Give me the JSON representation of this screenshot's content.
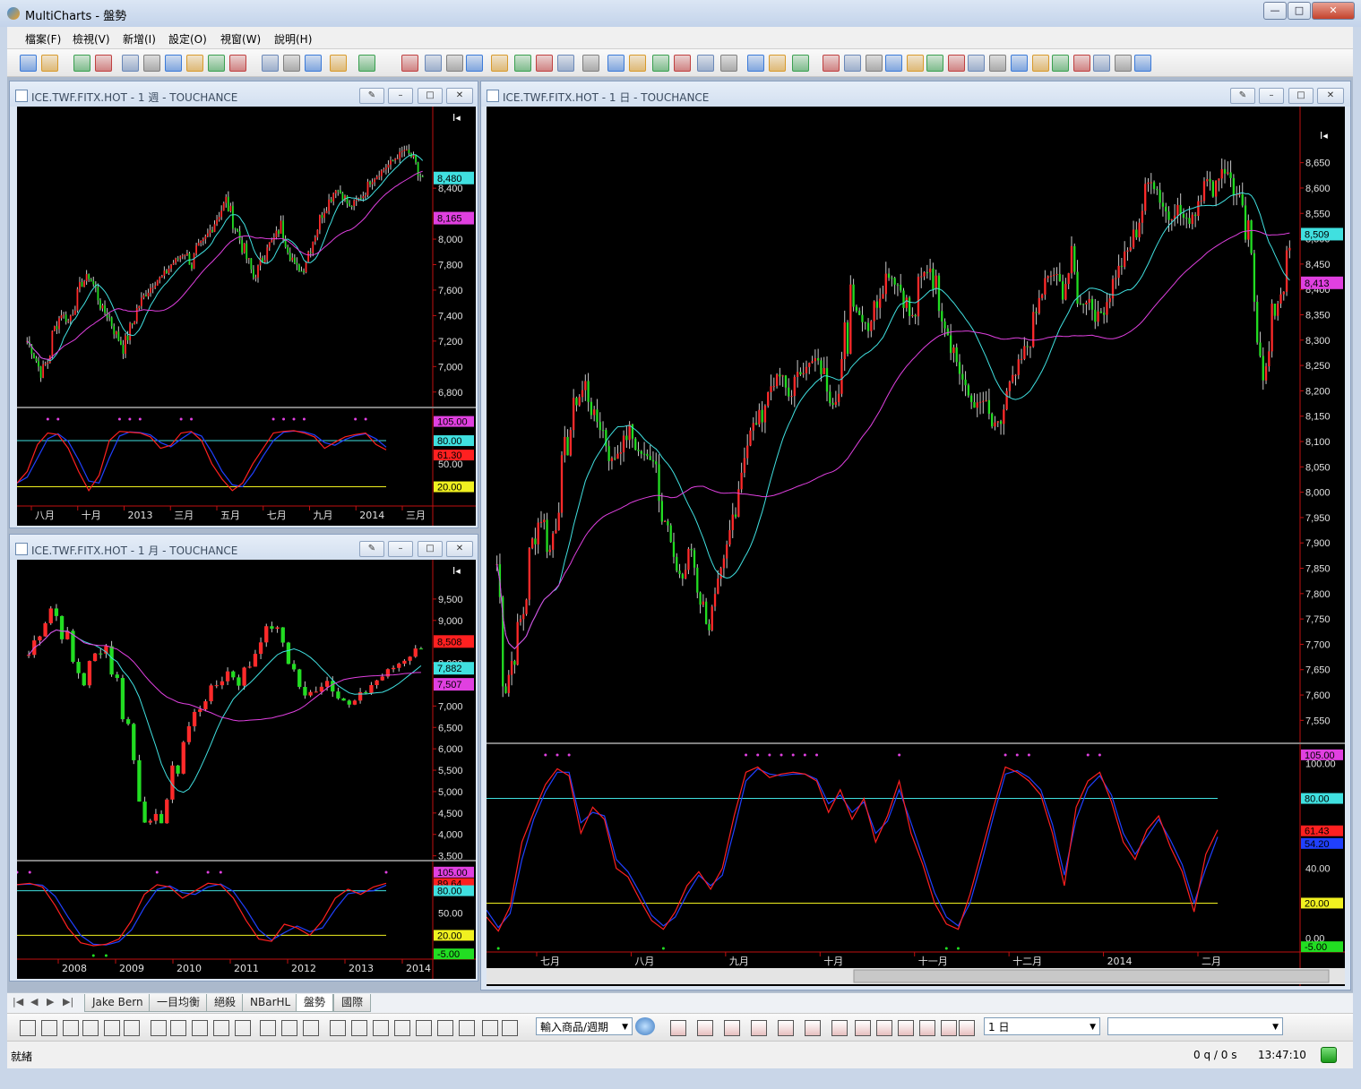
{
  "app": {
    "title": "MultiCharts - 盤勢"
  },
  "menu": [
    "檔案(F)",
    "檢視(V)",
    "新增(I)",
    "設定(O)",
    "視窗(W)",
    "說明(H)"
  ],
  "windows": {
    "weekly": {
      "title": "ICE.TWF.FITX.HOT - 1 週 - TOUCHANCE"
    },
    "monthly": {
      "title": "ICE.TWF.FITX.HOT - 1 月 - TOUCHANCE"
    },
    "daily": {
      "title": "ICE.TWF.FITX.HOT - 1 日 - TOUCHANCE"
    }
  },
  "tabs": [
    "Jake Bern",
    "一目均衡",
    "絕殺",
    "NBarHL",
    "盤勢",
    "國際"
  ],
  "active_tab": "盤勢",
  "symbol_combo": "輸入商品/週期",
  "interval_combo": "1 日",
  "status": {
    "text": "就緒",
    "queue": "0 q / 0 s",
    "time": "13:47:10"
  },
  "colors": {
    "up": "#ff2a2a",
    "down": "#22dd22",
    "fast_ma": "#40e0e0",
    "slow_ma": "#e040e0",
    "k_line": "#ff2020",
    "d_line": "#2040ff",
    "level_high": "#40e0e0",
    "level_low": "#f0f020"
  },
  "chart_data": [
    {
      "id": "daily",
      "type": "candlestick",
      "price_ticks": [
        "8,650",
        "8,600",
        "8,550",
        "8,500",
        "8,450",
        "8,400",
        "8,350",
        "8,300",
        "8,250",
        "8,200",
        "8,150",
        "8,100",
        "8,050",
        "8,000",
        "7,950",
        "7,900",
        "7,850",
        "7,800",
        "7,750",
        "7,700",
        "7,650",
        "7,600",
        "7,550"
      ],
      "price_range": [
        7510,
        8690
      ],
      "price_tags": [
        {
          "label": "8,509",
          "value": 8509,
          "color": "#40e0e0"
        },
        {
          "label": "8,413",
          "value": 8413,
          "color": "#e040e0"
        }
      ],
      "close_path": [
        7860,
        7620,
        7690,
        7770,
        7900,
        7960,
        7880,
        8000,
        8100,
        8180,
        8210,
        8150,
        8120,
        8060,
        8090,
        8120,
        8080,
        8070,
        8060,
        7950,
        7860,
        7830,
        7890,
        7790,
        7740,
        7800,
        7870,
        7990,
        8080,
        8130,
        8160,
        8210,
        8230,
        8190,
        8230,
        8250,
        8260,
        8230,
        8180,
        8200,
        8410,
        8350,
        8330,
        8380,
        8430,
        8420,
        8390,
        8330,
        8420,
        8450,
        8380,
        8320,
        8260,
        8200,
        8170,
        8180,
        8130,
        8140,
        8210,
        8240,
        8290,
        8350,
        8420,
        8430,
        8400,
        8450,
        8370,
        8380,
        8340,
        8380,
        8430,
        8460,
        8500,
        8560,
        8630,
        8580,
        8540,
        8560,
        8530,
        8560,
        8620,
        8600,
        8640,
        8620,
        8560,
        8480,
        8340,
        8220,
        8360,
        8420,
        8500
      ],
      "osc_ticks": [
        "100.00",
        "40.00",
        "0.00"
      ],
      "osc_range": [
        -8,
        108
      ],
      "osc_levels": [
        80,
        20
      ],
      "osc_tags": [
        {
          "label": "105.00",
          "value": 105,
          "color": "#e040e0"
        },
        {
          "label": "80.00",
          "value": 80,
          "color": "#40e0e0"
        },
        {
          "label": "61.43",
          "value": 61.43,
          "color": "#ff2020"
        },
        {
          "label": "54.20",
          "value": 54.2,
          "color": "#2040ff"
        },
        {
          "label": "20.00",
          "value": 20,
          "color": "#f0f020"
        },
        {
          "label": "-5.00",
          "value": -5,
          "color": "#22dd22"
        }
      ],
      "osc_k": [
        12,
        4,
        18,
        55,
        72,
        88,
        97,
        93,
        60,
        75,
        68,
        40,
        35,
        22,
        10,
        5,
        15,
        30,
        38,
        28,
        40,
        70,
        95,
        98,
        92,
        94,
        95,
        94,
        90,
        72,
        85,
        68,
        80,
        55,
        70,
        90,
        60,
        42,
        20,
        8,
        5,
        25,
        50,
        75,
        98,
        95,
        90,
        82,
        60,
        30,
        75,
        90,
        95,
        78,
        55,
        45,
        62,
        70,
        52,
        38,
        15,
        48,
        62
      ],
      "osc_d": [
        16,
        6,
        14,
        45,
        68,
        84,
        95,
        95,
        66,
        72,
        70,
        45,
        38,
        26,
        13,
        7,
        12,
        25,
        36,
        30,
        36,
        62,
        90,
        97,
        94,
        93,
        94,
        94,
        91,
        77,
        82,
        72,
        78,
        60,
        67,
        85,
        66,
        46,
        26,
        12,
        7,
        20,
        44,
        70,
        94,
        96,
        92,
        85,
        65,
        36,
        68,
        86,
        93,
        82,
        60,
        48,
        58,
        68,
        56,
        42,
        20,
        40,
        58
      ],
      "x_labels": [
        "七月",
        "八月",
        "九月",
        "十月",
        "十一月",
        "十二月",
        "2014",
        "二月"
      ]
    },
    {
      "id": "weekly",
      "type": "candlestick",
      "price_ticks": [
        "8,400",
        "8,000",
        "7,800",
        "7,600",
        "7,400",
        "7,200",
        "7,000",
        "6,800"
      ],
      "price_range": [
        6700,
        8900
      ],
      "price_tags": [
        {
          "label": "8,480",
          "value": 8480,
          "color": "#40e0e0"
        },
        {
          "label": "8,165",
          "value": 8165,
          "color": "#e040e0"
        }
      ],
      "close_path": [
        7200,
        7100,
        6950,
        7050,
        7300,
        7420,
        7350,
        7500,
        7650,
        7720,
        7600,
        7450,
        7380,
        7250,
        7150,
        7280,
        7450,
        7550,
        7620,
        7680,
        7720,
        7800,
        7850,
        7900,
        7800,
        7950,
        8000,
        8100,
        8200,
        8300,
        8150,
        8000,
        7850,
        7700,
        7800,
        7950,
        8000,
        8100,
        7950,
        7800,
        7750,
        7900,
        8050,
        8200,
        8300,
        8400,
        8350,
        8250,
        8300,
        8350,
        8450,
        8500,
        8550,
        8600,
        8650,
        8700,
        8650,
        8500,
        8480
      ],
      "osc_ticks": [
        "50.00"
      ],
      "osc_range": [
        -5,
        115
      ],
      "osc_levels": [
        80,
        20
      ],
      "osc_tags": [
        {
          "label": "105.00",
          "value": 105,
          "color": "#e040e0"
        },
        {
          "label": "80.00",
          "value": 80,
          "color": "#40e0e0"
        },
        {
          "label": "61.30",
          "value": 61.3,
          "color": "#ff2020"
        },
        {
          "label": "20.00",
          "value": 20,
          "color": "#f0f020"
        }
      ],
      "osc_k": [
        25,
        40,
        75,
        90,
        88,
        70,
        40,
        15,
        35,
        80,
        92,
        91,
        90,
        85,
        70,
        74,
        90,
        92,
        80,
        50,
        30,
        15,
        25,
        50,
        70,
        90,
        92,
        93,
        90,
        85,
        70,
        78,
        85,
        88,
        90,
        75,
        68
      ],
      "x_labels": [
        "八月",
        "十月",
        "2013",
        "三月",
        "五月",
        "七月",
        "九月",
        "2014",
        "三月"
      ]
    },
    {
      "id": "monthly",
      "type": "candlestick",
      "price_ticks": [
        "9,500",
        "9,000",
        "8,000",
        "7,000",
        "6,500",
        "6,000",
        "5,500",
        "5,000",
        "4,500",
        "4,000",
        "3,500"
      ],
      "price_range": [
        3450,
        10000
      ],
      "price_tags": [
        {
          "label": "8,508",
          "value": 8508,
          "color": "#ff2020"
        },
        {
          "label": "7,882",
          "value": 7882,
          "color": "#40e0e0"
        },
        {
          "label": "7,507",
          "value": 7507,
          "color": "#e040e0"
        }
      ],
      "close_path": [
        8200,
        8800,
        9300,
        8900,
        8000,
        7600,
        8200,
        8400,
        7500,
        6500,
        5000,
        4200,
        4500,
        5200,
        6200,
        6800,
        7200,
        7500,
        7800,
        7600,
        8000,
        8600,
        8900,
        8500,
        7800,
        7200,
        7400,
        7600,
        7300,
        7000,
        7200,
        7500,
        7700,
        7900,
        8100,
        8300,
        8500
      ],
      "osc_ticks": [
        "50.00"
      ],
      "osc_range": [
        -12,
        112
      ],
      "osc_levels": [
        80,
        20
      ],
      "osc_tags": [
        {
          "label": "105.00",
          "value": 105,
          "color": "#e040e0"
        },
        {
          "label": "89.64",
          "value": 89.64,
          "color": "#ff2020"
        },
        {
          "label": "80.00",
          "value": 80,
          "color": "#40e0e0"
        },
        {
          "label": "20.00",
          "value": 20,
          "color": "#f0f020"
        },
        {
          "label": "-5.00",
          "value": -5,
          "color": "#22dd22"
        }
      ],
      "osc_k": [
        88,
        90,
        85,
        60,
        30,
        10,
        6,
        8,
        15,
        40,
        75,
        88,
        85,
        70,
        80,
        90,
        88,
        70,
        40,
        15,
        12,
        35,
        30,
        20,
        40,
        70,
        82,
        75,
        85,
        90
      ],
      "x_labels": [
        "2008",
        "2009",
        "2010",
        "2011",
        "2012",
        "2013",
        "2014"
      ]
    }
  ]
}
